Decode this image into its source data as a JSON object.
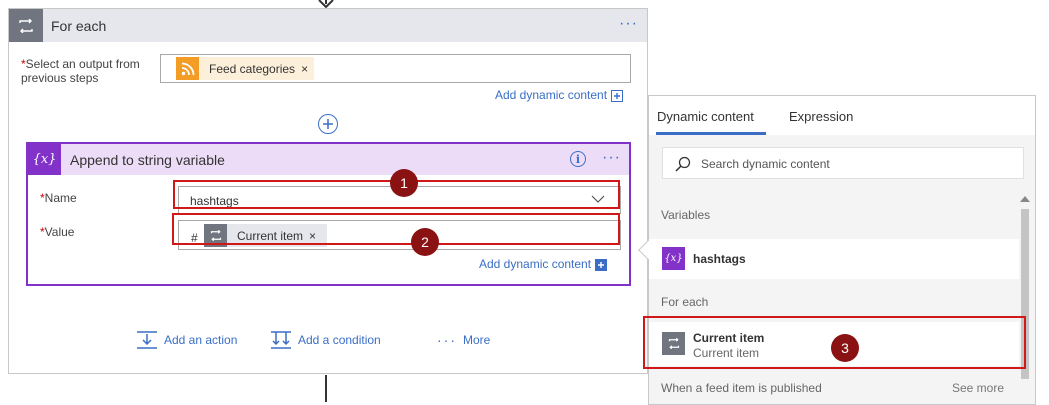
{
  "foreach": {
    "title": "For each",
    "menu": "···",
    "select_label": "Select an output from previous steps",
    "required_mark": "*",
    "token_label": "Feed categories",
    "token_remove": "×",
    "add_dynamic": "Add dynamic content"
  },
  "append": {
    "icon_text": "{x}",
    "title": "Append to string variable",
    "info": "i",
    "menu": "···",
    "name_label": "Name",
    "name_value": "hashtags",
    "value_label": "Value",
    "value_prefix": "#",
    "value_token": "Current item",
    "token_remove": "×",
    "add_dynamic": "Add dynamic content"
  },
  "badges": [
    "1",
    "2",
    "3"
  ],
  "actions": {
    "add_action": "Add an action",
    "add_condition": "Add a condition",
    "more_dots": "···",
    "more": "More"
  },
  "dynamic_panel": {
    "tabs": [
      "Dynamic content",
      "Expression"
    ],
    "active_tab": "Dynamic content",
    "search_placeholder": "Search dynamic content",
    "section_variables": "Variables",
    "variable_icon": "{x}",
    "variable_item": "hashtags",
    "section_foreach": "For each",
    "current_item_title": "Current item",
    "current_item_sub": "Current item",
    "section_trigger": "When a feed item is published",
    "see_more": "See more"
  },
  "colors": {
    "accent": "#3a6ec6",
    "variable_purple": "#8232c8",
    "highlight_red": "#d01818",
    "badge": "#8b1212",
    "rss_orange": "#f39c26"
  }
}
